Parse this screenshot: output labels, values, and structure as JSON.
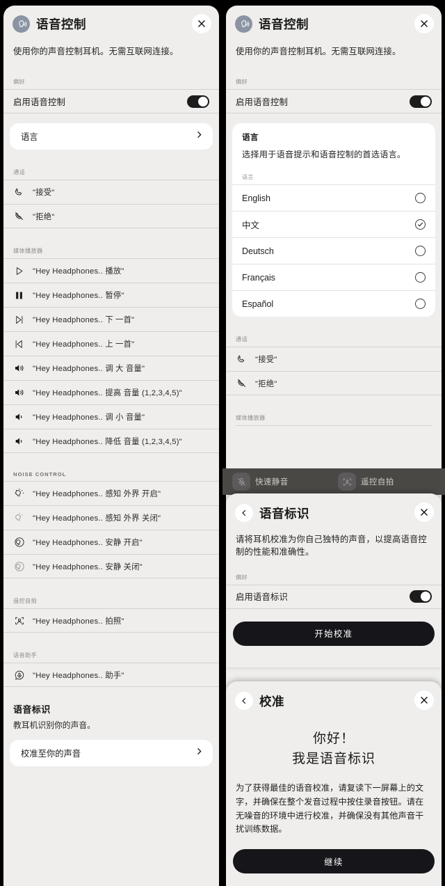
{
  "app": {
    "title": "语音控制",
    "subtitle": "使用你的声音控制耳机。无需互联网连接。",
    "icon": "voice-control-icon",
    "close_icon": "close-icon",
    "back_icon": "chevron-left-icon",
    "chevron_icon": "chevron-right-icon"
  },
  "left": {
    "pref_label": "偏好",
    "enable_row": {
      "label": "启用语音控制",
      "toggle_on": true
    },
    "language_card": {
      "label": "语言"
    },
    "calls": {
      "label": "通话",
      "items": [
        {
          "icon": "phone-icon",
          "label": "\"接受\""
        },
        {
          "icon": "phone-slash-icon",
          "label": "\"拒绝\""
        }
      ]
    },
    "media": {
      "label": "媒体播放器",
      "items": [
        {
          "icon": "play-icon",
          "label": "\"Hey Headphones.. 播放\""
        },
        {
          "icon": "pause-icon",
          "label": "\"Hey Headphones.. 暂停\""
        },
        {
          "icon": "next-track-icon",
          "label": "\"Hey Headphones.. 下 一首\""
        },
        {
          "icon": "prev-track-icon",
          "label": "\"Hey Headphones.. 上 一首\""
        },
        {
          "icon": "volume-up-icon",
          "label": "\"Hey Headphones.. 调 大 音量\""
        },
        {
          "icon": "volume-up-icon",
          "label": "\"Hey Headphones.. 提高 音量 (1,2,3,4,5)\""
        },
        {
          "icon": "volume-down-icon",
          "label": "\"Hey Headphones.. 调 小 音量\""
        },
        {
          "icon": "volume-down-icon",
          "label": "\"Hey Headphones.. 降低 音量 (1,2,3,4,5)\""
        }
      ]
    },
    "noise": {
      "label": "NOISE CONTROL",
      "items": [
        {
          "icon": "awareness-on-icon",
          "label": "\"Hey Headphones.. 感知 外界 开启\""
        },
        {
          "icon": "awareness-off-icon",
          "label": "\"Hey Headphones.. 感知 外界 关闭\""
        },
        {
          "icon": "quiet-on-icon",
          "label": "\"Hey Headphones.. 安静 开启\""
        },
        {
          "icon": "quiet-off-icon",
          "label": "\"Hey Headphones.. 安静 关闭\""
        }
      ]
    },
    "selfie": {
      "label": "遥控自拍",
      "items": [
        {
          "icon": "camera-shutter-icon",
          "label": "\"Hey Headphones.. 拍照\""
        }
      ]
    },
    "assistant": {
      "label": "语音助手",
      "items": [
        {
          "icon": "assistant-mic-icon",
          "label": "\"Hey Headphones.. 助手\""
        }
      ]
    },
    "voice_id": {
      "title": "语音标识",
      "desc": "教耳机识别你的声音。",
      "nav_label": "校准至你的声音"
    }
  },
  "right": {
    "pref_label": "偏好",
    "enable_row": {
      "label": "启用语音控制",
      "toggle_on": true
    },
    "language_card": {
      "title": "语言",
      "desc": "选择用于语音提示和语音控制的首选语言。",
      "section_label": "语言",
      "options": [
        {
          "label": "English",
          "selected": false
        },
        {
          "label": "中文",
          "selected": true
        },
        {
          "label": "Deutsch",
          "selected": false
        },
        {
          "label": "Français",
          "selected": false
        },
        {
          "label": "Español",
          "selected": false
        }
      ]
    },
    "calls": {
      "label": "通话",
      "items": [
        {
          "icon": "phone-icon",
          "label": "\"接受\""
        },
        {
          "icon": "phone-slash-icon",
          "label": "\"拒绝\""
        }
      ]
    },
    "media_label": "媒体播放器",
    "backdrop": {
      "tiles": [
        {
          "icon": "mic-mute-icon",
          "label": "快速静音"
        },
        {
          "icon": "selfie-remote-icon",
          "label": "遥控自拍"
        }
      ]
    },
    "voice_id_sheet": {
      "title": "语音标识",
      "desc": "请将耳机校准为你自己独特的声音，以提高语音控制的性能和准确性。",
      "pref_label": "偏好",
      "enable_row": {
        "label": "启用语音标识",
        "toggle_on": true
      },
      "primary_button": "开始校准"
    },
    "calibration_sheet": {
      "title": "校准",
      "greeting_line1": "你好！",
      "greeting_line2": "我是语音标识",
      "body": "为了获得最佳的语音校准，请复读下一屏幕上的文字，并确保在整个发音过程中按住录音按钮。请在无噪音的环境中进行校准，并确保没有其他声音干扰训练数据。",
      "primary_button": "继续"
    }
  },
  "colors": {
    "sheet_bg": "#efeeec",
    "card_bg": "#ffffff",
    "text": "#1b1b1b",
    "muted": "#8d8d8d",
    "divider": "#d3d2cf",
    "accent_dark": "#16161a",
    "app_icon_bg": "#8b94a3",
    "backdrop": "#4a4845"
  }
}
